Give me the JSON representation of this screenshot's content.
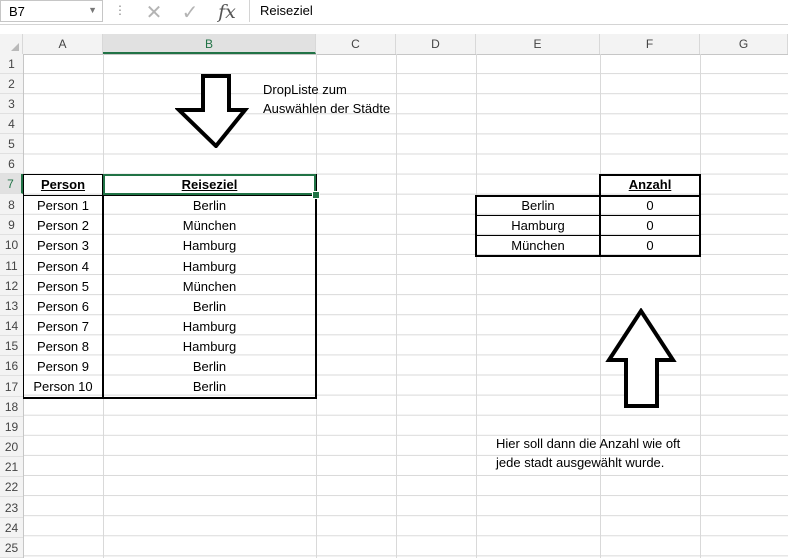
{
  "formula_bar": {
    "namebox": "B7",
    "dots": "⋮",
    "cancel_icon": "✕",
    "confirm_icon": "✓",
    "fx_label": "fx",
    "formula": "Reiseziel"
  },
  "columns": [
    "A",
    "B",
    "C",
    "D",
    "E",
    "F",
    "G"
  ],
  "rows": [
    "1",
    "2",
    "3",
    "4",
    "5",
    "6",
    "7",
    "8",
    "9",
    "10",
    "11",
    "12",
    "13",
    "14",
    "15",
    "16",
    "17",
    "18",
    "19",
    "20",
    "21",
    "22",
    "23",
    "24",
    "25"
  ],
  "table1": {
    "headers": [
      "Person",
      "Reiseziel"
    ],
    "rows": [
      [
        "Person 1",
        "Berlin"
      ],
      [
        "Person 2",
        "München"
      ],
      [
        "Person 3",
        "Hamburg"
      ],
      [
        "Person 4",
        "Hamburg"
      ],
      [
        "Person 5",
        "München"
      ],
      [
        "Person 6",
        "Berlin"
      ],
      [
        "Person 7",
        "Hamburg"
      ],
      [
        "Person 8",
        "Hamburg"
      ],
      [
        "Person 9",
        "Berlin"
      ],
      [
        "Person 10",
        "Berlin"
      ]
    ]
  },
  "table2": {
    "header": "Anzahl",
    "rows": [
      [
        "Berlin",
        "0"
      ],
      [
        "Hamburg",
        "0"
      ],
      [
        "München",
        "0"
      ]
    ]
  },
  "notes": {
    "top_line1": "DropListe zum",
    "top_line2": "Auswählen der Städte",
    "bottom_line1": "Hier soll dann die Anzahl wie oft",
    "bottom_line2": "jede stadt ausgewählt wurde."
  }
}
